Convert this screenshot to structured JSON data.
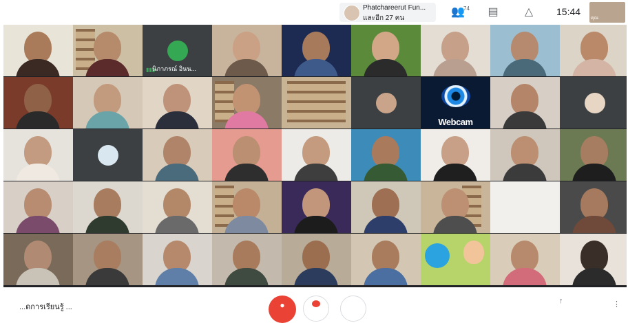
{
  "topbar": {
    "host_name": "Phatchareerut Fun...",
    "host_sub": "และอีก 27 คน",
    "people_count": "74",
    "clock": "15:44",
    "self_label": "คุณ"
  },
  "participant_name": "นิภาภรณ์ อินน...",
  "webcam_text": "Webcam",
  "bottombar": {
    "meeting_code": "...ดการเรียนรู้ ...",
    "present_label": "↑"
  },
  "colors": {
    "grid_bg": "#202124",
    "call_end": "#ea4335",
    "avatar_green": "#34a853"
  }
}
